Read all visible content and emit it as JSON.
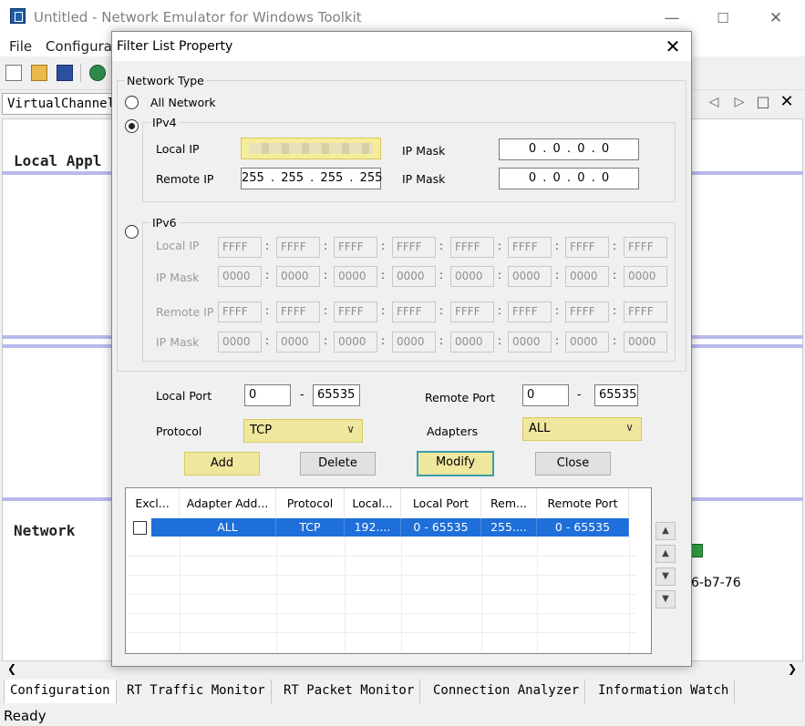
{
  "app": {
    "title": "Untitled - Network Emulator for Windows Toolkit",
    "menu": [
      "File",
      "Configurat"
    ],
    "vc_label": "VirtualChannel",
    "local_label": "Local Appl",
    "network_label": "Network",
    "partial_mac": "6-b7-76",
    "status": "Ready",
    "tabs": [
      "Configuration",
      "RT Traffic Monitor",
      "RT Packet Monitor",
      "Connection Analyzer",
      "Information Watch"
    ]
  },
  "dialog": {
    "title": "Filter List Property",
    "network_type": "Network Type",
    "all_network": "All Network",
    "ipv4": "IPv4",
    "ipv6": "IPv6",
    "selected": "IPv4",
    "v4": {
      "local_ip_label": "Local IP",
      "local_ip": "",
      "ip_mask_label": "IP Mask",
      "local_mask": "0 . 0 . 0 . 0",
      "remote_ip_label": "Remote IP",
      "remote_ip": "255 . 255 . 255 . 255",
      "remote_mask": "0 . 0 . 0 . 0"
    },
    "v6": {
      "local_ip_label": "Local IP",
      "ip_mask_label": "IP Mask",
      "remote_ip_label": "Remote IP",
      "ip_seg": "FFFF",
      "mask_seg": "0000"
    },
    "local_port_label": "Local Port",
    "local_port_from": "0",
    "local_port_to": "65535",
    "remote_port_label": "Remote Port",
    "remote_port_from": "0",
    "remote_port_to": "65535",
    "protocol_label": "Protocol",
    "protocol": "TCP",
    "adapters_label": "Adapters",
    "adapters": "ALL",
    "buttons": {
      "add": "Add",
      "delete": "Delete",
      "modify": "Modify",
      "close": "Close"
    },
    "table": {
      "headers": [
        "Excl...",
        "Adapter Add...",
        "Protocol",
        "Local...",
        "Local Port",
        "Rem...",
        "Remote Port"
      ],
      "rows": [
        [
          "",
          "ALL",
          "TCP",
          "192....",
          "0 - 65535",
          "255....",
          "0 - 65535"
        ]
      ]
    },
    "colors": {
      "highlight": "#efe79e",
      "selection": "#1e6fd9"
    }
  }
}
